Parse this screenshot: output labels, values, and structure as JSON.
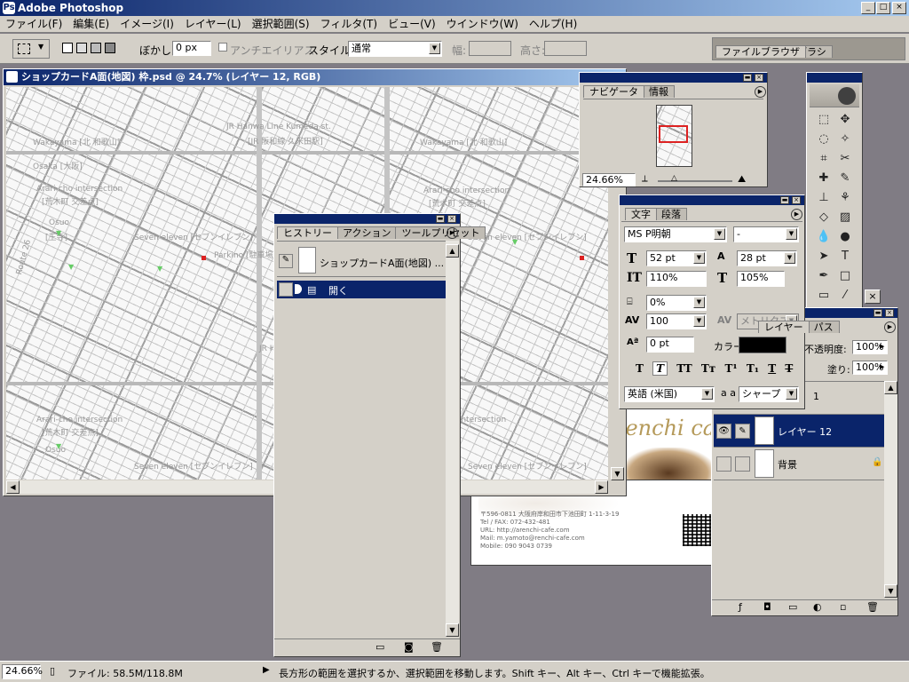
{
  "app": {
    "title": "Adobe Photoshop"
  },
  "menu": [
    "ファイル(F)",
    "編集(E)",
    "イメージ(I)",
    "レイヤー(L)",
    "選択範囲(S)",
    "フィルタ(T)",
    "ビュー(V)",
    "ウインドウ(W)",
    "ヘルプ(H)"
  ],
  "options": {
    "feather_label": "ぼかし:",
    "feather_value": "0 px",
    "antialias_label": "アンチエイリアス",
    "style_label": "スタイル:",
    "style_value": "通常",
    "width_label": "幅:",
    "height_label": "高さ:",
    "file_browser_tab": "ファイルブラウザ",
    "brushes_tab": "ブラシ"
  },
  "document": {
    "title": "ショップカードA面(地図) 枠.psd @ 24.7% (レイヤー 12, RGB)",
    "map_labels": [
      "Wakayama [北 和歌山]",
      "JR Hanwa Line Kumeda st.",
      "[JR 阪和線 久米田駅]",
      "Osaka [大阪]",
      "Arari-cho intersection",
      "[荒木町 交差点]",
      "Osuo",
      "[王寺]",
      "Seven eleven [セブンイレブン]",
      "Parkino [駐車場]",
      "Route 26"
    ]
  },
  "navigator": {
    "tabs": [
      "ナビゲータ",
      "情報"
    ],
    "zoom": "24.66%"
  },
  "history": {
    "tabs": [
      "ヒストリー",
      "アクション",
      "ツールプリセット"
    ],
    "snapshot": "ショップカードA面(地図) ...",
    "step": "開く"
  },
  "character": {
    "tabs": [
      "文字",
      "段落"
    ],
    "font_family": "MS P明朝",
    "font_style": "-",
    "size": "52 pt",
    "leading": "28 pt",
    "vscale": "110%",
    "hscale": "105%",
    "kerning": "0%",
    "tracking": "100",
    "kerning_mode": "メトリクス",
    "baseline": "0 pt",
    "color_label": "カラー:",
    "color": "#000000",
    "language": "英語 (米国)",
    "aa_label": "a a",
    "antialias": "シャープ"
  },
  "card": {
    "brand": "renchi cafe",
    "lines": [
      "〒596-0811 大阪府岸和田市下池田町 1-11-3-19",
      "Tel / FAX: 072-432-481",
      "URL: http://arenchi-cafe.com",
      "Mail: m.yamoto@renchi-cafe.com",
      "Mobile: 090 9043 0739"
    ]
  },
  "layers": {
    "tabs": [
      "レイヤー",
      "パス"
    ],
    "opacity_label": "不透明度:",
    "opacity": "100%",
    "fill_label": "塗り:",
    "fill": "100%",
    "partial_row": "1",
    "items": [
      {
        "name": "レイヤー 12",
        "selected": true
      },
      {
        "name": "背景",
        "selected": false
      }
    ]
  },
  "status": {
    "zoom": "24.66%",
    "file_info": "ファイル: 58.5M/118.8M",
    "message": "長方形の範囲を選択するか、選択範囲を移動します。Shift キー、Alt キー、Ctrl キーで機能拡張。"
  }
}
